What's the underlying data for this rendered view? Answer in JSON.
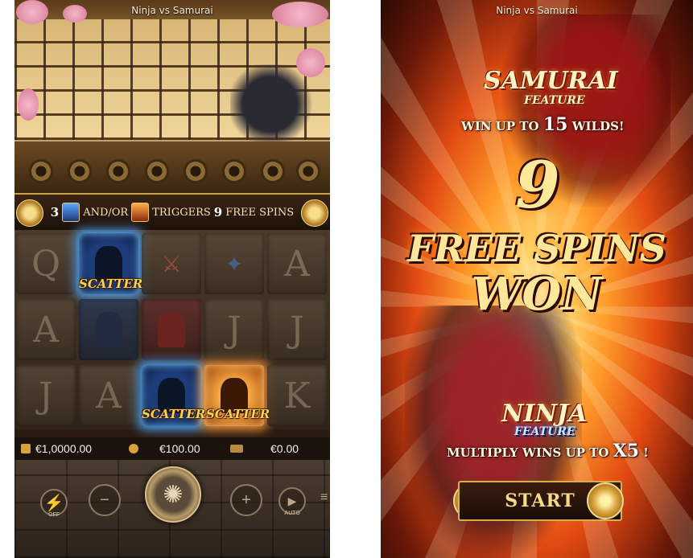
{
  "left_screen": {
    "title": "Ninja vs Samurai",
    "trigger_bar": {
      "count": "3",
      "andor": "AND/OR",
      "triggers_text": "TRIGGERS",
      "free_spins_count": "9",
      "free_spins_label": "FREE SPINS"
    },
    "reels": {
      "scatter_label": "SCATTER",
      "row1": [
        "Q",
        "",
        "",
        "",
        "A"
      ],
      "row2": [
        "A",
        "",
        "",
        "J",
        "J"
      ],
      "row3": [
        "J",
        "A",
        "",
        "",
        "K"
      ]
    },
    "balance": "€1,0000.00",
    "bet": "€100.00",
    "win": "€0.00",
    "controls": {
      "turbo_sub": "OFF",
      "auto_sub": "AUTO"
    }
  },
  "right_screen": {
    "title": "Ninja vs Samurai",
    "samurai_feature": {
      "title_line1": "SAMURAI",
      "title_line2": "FEATURE",
      "subtitle_prefix": "WIN UP TO",
      "subtitle_value": "15",
      "subtitle_suffix": "WILDS!"
    },
    "free_spins_won": {
      "count": "9",
      "line1": "FREE SPINS",
      "line2": "WON"
    },
    "ninja_feature": {
      "title_line1": "NINJA",
      "title_line2": "FEATURE",
      "subtitle_prefix": "MULTIPLY WINS UP TO",
      "subtitle_value": "X5",
      "subtitle_suffix": "!"
    },
    "start_label": "START"
  },
  "colors": {
    "gold": "#d8b04a",
    "scatter_blue_glow": "#4fa8ff",
    "scatter_orange_glow": "#ff9a3a",
    "burst_center": "#ffd36a"
  }
}
